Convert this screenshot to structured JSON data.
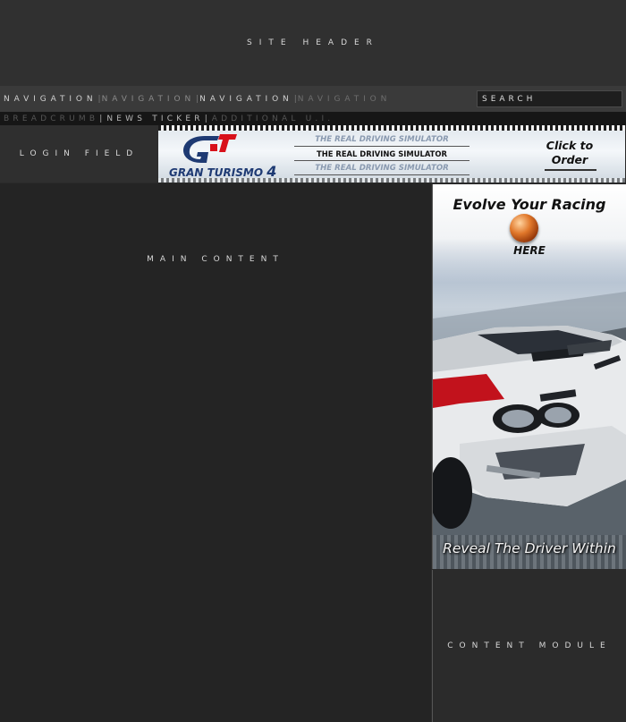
{
  "header": {
    "label": "SITE HEADER"
  },
  "nav": {
    "items": [
      {
        "label": "NAVIGATION",
        "color": "#d0d0d0"
      },
      {
        "label": "NAVIGATION",
        "color": "#8a8a8a"
      },
      {
        "label": "NAVIGATION",
        "color": "#d0d0d0"
      },
      {
        "label": "NAVIGATION",
        "color": "#6e6e6e"
      }
    ],
    "separator": "|",
    "search_label": "SEARCH"
  },
  "subbar": {
    "items": [
      {
        "label": "BREADCRUMB",
        "color": "#555555"
      },
      {
        "label": "NEWS TICKER",
        "color": "#b8b8b8"
      },
      {
        "label": "ADDITIONAL U.I.",
        "color": "#555555"
      }
    ],
    "separator": "|"
  },
  "login": {
    "label": "LOGIN FIELD"
  },
  "banner": {
    "brand": "GRAN TURISMO",
    "brand_number": "4",
    "slogans": [
      "THE REAL DRIVING SIMULATOR",
      "THE REAL DRIVING SIMULATOR",
      "THE REAL DRIVING SIMULATOR"
    ],
    "cta_line1": "Click to",
    "cta_line2": "Order",
    "colors": {
      "logo_blue": "#1e3a73",
      "logo_red": "#d8101a"
    }
  },
  "main": {
    "label": "MAIN CONTENT"
  },
  "ad": {
    "headline": "Evolve Your Racing",
    "here": "HERE",
    "footer": "Reveal The Driver Within"
  },
  "content_module": {
    "label": "CONTENT MODULE"
  }
}
